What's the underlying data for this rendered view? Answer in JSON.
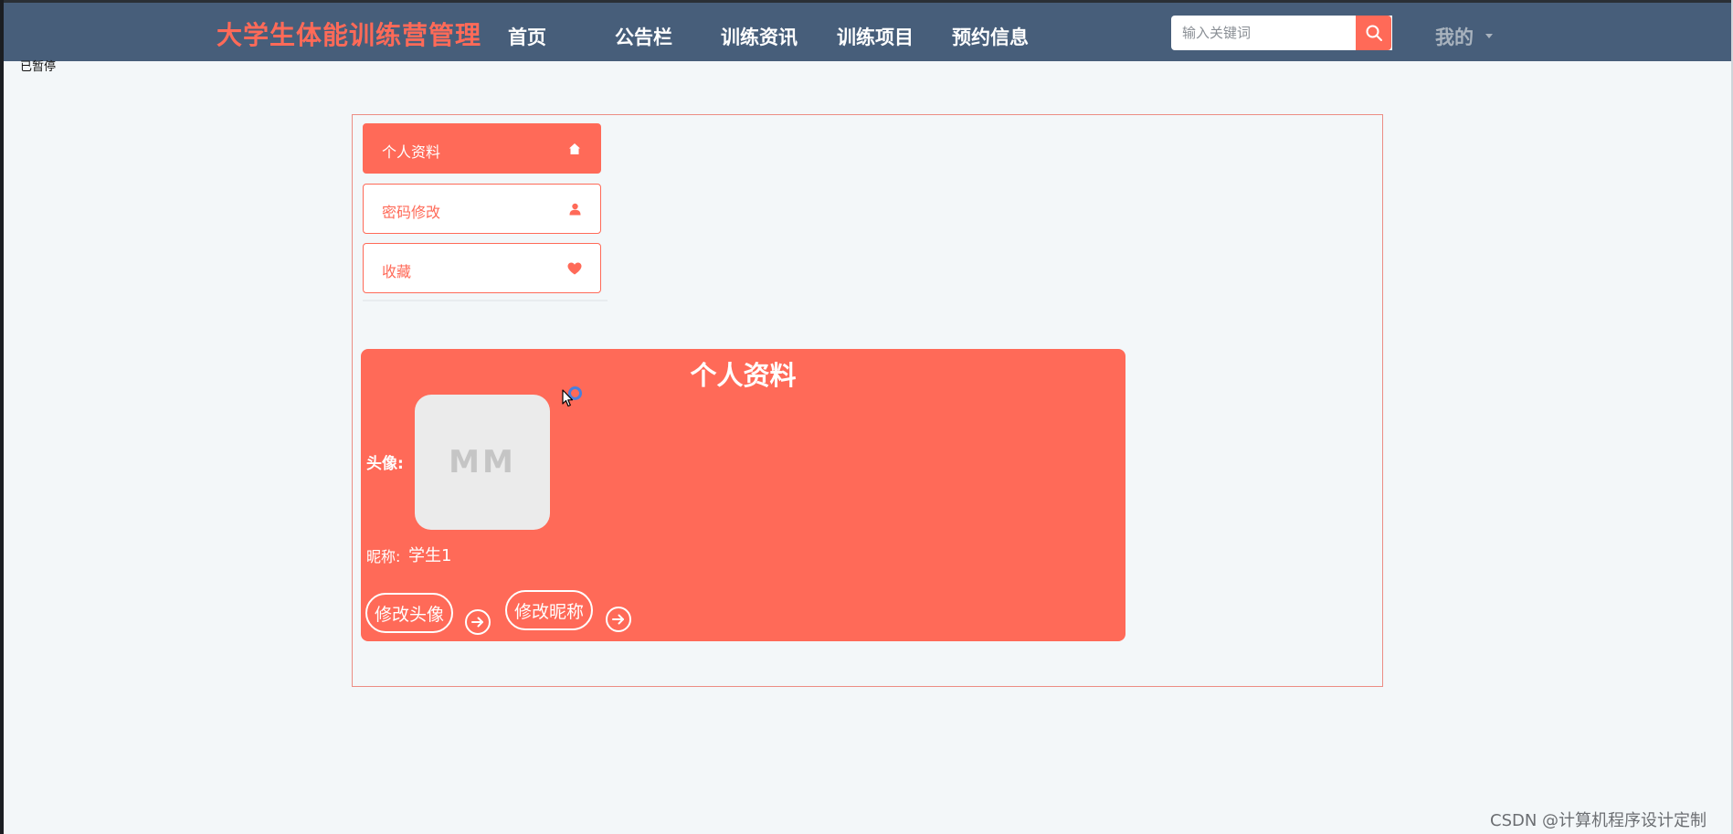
{
  "header": {
    "brand": "大学生体能训练营管理",
    "nav": [
      "首页",
      "公告栏",
      "训练资讯",
      "训练项目",
      "预约信息"
    ],
    "search_placeholder": "输入关键词",
    "mine": "我的"
  },
  "overlay": {
    "paused_label": "已暂停"
  },
  "sidebar": {
    "items": [
      {
        "label": "个人资料",
        "icon": "home-icon",
        "active": true
      },
      {
        "label": "密码修改",
        "icon": "user-icon",
        "active": false
      },
      {
        "label": "收藏",
        "icon": "heart-icon",
        "active": false
      }
    ]
  },
  "profile": {
    "title": "个人资料",
    "avatar_label": "头像:",
    "avatar_initials": "MM",
    "nickname_label": "昵称:",
    "nickname_value": "学生1",
    "change_avatar_button": "修改头像",
    "change_nickname_button": "修改昵称"
  },
  "watermark": "CSDN @计算机程序设计定制",
  "colors": {
    "accent": "#ff6a58",
    "navbar": "#475e7a",
    "page_bg": "#f3f7f9"
  }
}
